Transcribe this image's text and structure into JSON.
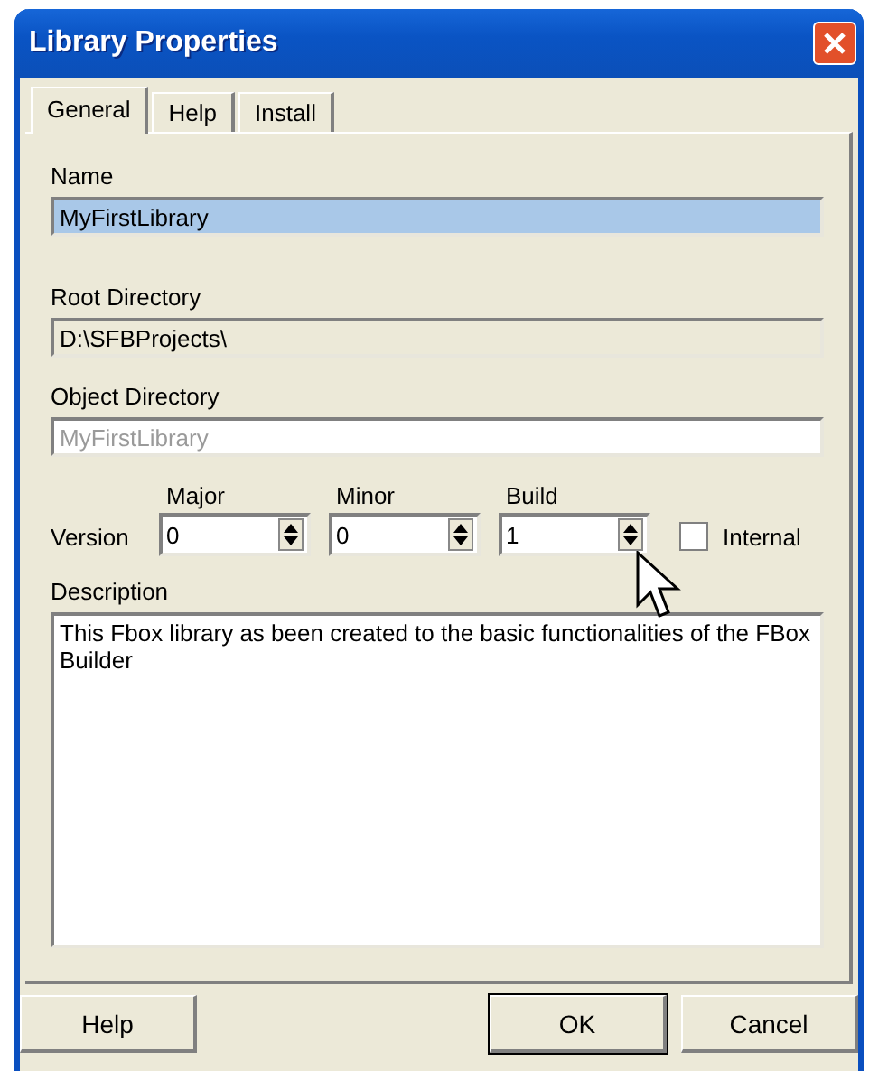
{
  "window": {
    "title": "Library Properties"
  },
  "tabs": [
    {
      "label": "General",
      "selected": true
    },
    {
      "label": "Help",
      "selected": false
    },
    {
      "label": "Install",
      "selected": false
    }
  ],
  "name": {
    "label": "Name",
    "value": "MyFirstLibrary",
    "selected": true
  },
  "root_directory": {
    "label": "Root Directory",
    "value": "D:\\SFBProjects\\",
    "disabled": true
  },
  "object_directory": {
    "label": "Object Directory",
    "value": "MyFirstLibrary",
    "disabled": true
  },
  "version": {
    "label": "Version",
    "spinners": [
      {
        "label": "Major",
        "value": "0"
      },
      {
        "label": "Minor",
        "value": "0"
      },
      {
        "label": "Build",
        "value": "1"
      }
    ],
    "internal": {
      "label": "Internal",
      "checked": false
    }
  },
  "description": {
    "label": "Description",
    "value": "This Fbox library as been created to the basic functionalities of the FBox Builder"
  },
  "buttons": [
    {
      "label": "Help",
      "kind": "left"
    },
    {
      "label": "OK",
      "kind": "default"
    },
    {
      "label": "Cancel",
      "kind": "normal"
    }
  ]
}
